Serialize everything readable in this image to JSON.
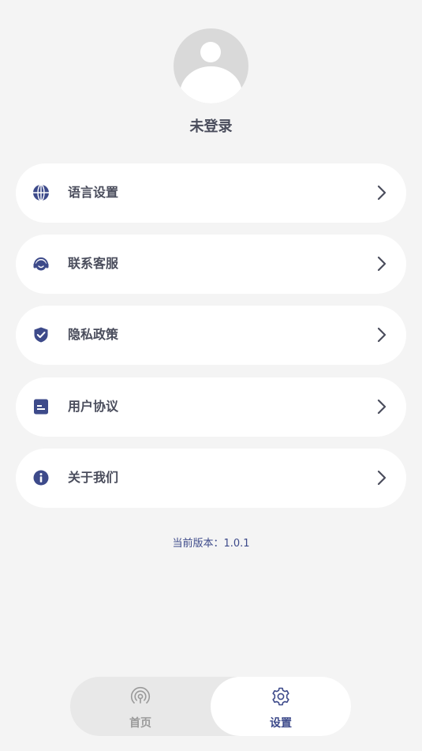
{
  "profile": {
    "username": "未登录"
  },
  "menu": {
    "items": [
      {
        "label": "语言设置",
        "icon": "globe-icon"
      },
      {
        "label": "联系客服",
        "icon": "headset-icon"
      },
      {
        "label": "隐私政策",
        "icon": "shield-check-icon"
      },
      {
        "label": "用户协议",
        "icon": "document-icon"
      },
      {
        "label": "关于我们",
        "icon": "info-icon"
      }
    ]
  },
  "version": {
    "text": "当前版本：1.0.1"
  },
  "tabbar": {
    "tabs": [
      {
        "label": "首页",
        "icon": "broadcast-icon",
        "active": false
      },
      {
        "label": "设置",
        "icon": "gear-icon",
        "active": true
      }
    ]
  },
  "colors": {
    "accent": "#3d4a8a",
    "background": "#f4f4f4",
    "card": "#ffffff",
    "text": "#4a4d5c",
    "inactive": "#9a9a9a"
  }
}
